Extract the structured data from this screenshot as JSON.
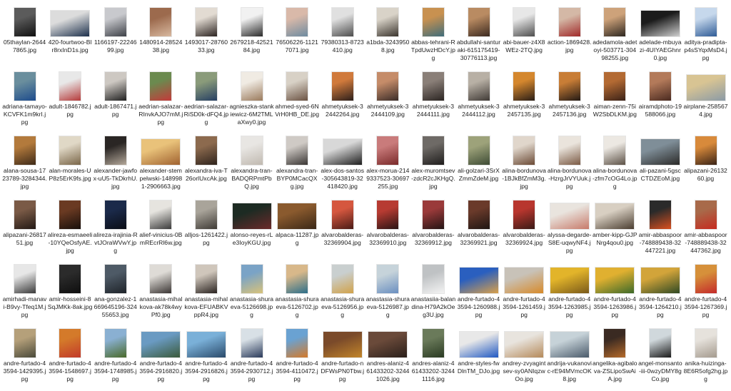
{
  "files": [
    {
      "name": "05thaylan-26447865.jpg",
      "orient": "port",
      "colors": [
        "#5b5b5b",
        "#101010"
      ]
    },
    {
      "name": "420-fourtwoo-Blr8rxInD1s.jpg",
      "orient": "land",
      "colors": [
        "#dcdcdc",
        "#1c2f4b"
      ]
    },
    {
      "name": "1166197-2224699.jpg",
      "orient": "port",
      "colors": [
        "#c8c9cd",
        "#3d4047"
      ]
    },
    {
      "name": "1480914-2852438.jpg",
      "orient": "port",
      "colors": [
        "#9c6a4d",
        "#d8b9a0"
      ]
    },
    {
      "name": "1493017-2876033.jpg",
      "orient": "port",
      "colors": [
        "#e2dbd2",
        "#2b2320"
      ]
    },
    {
      "name": "2679218-4252184.jpg",
      "orient": "port",
      "colors": [
        "#f1f1f1",
        "#2a2a2a"
      ]
    },
    {
      "name": "76506226-11217071.jpg",
      "orient": "port",
      "colors": [
        "#d9b9a9",
        "#6e8ba0"
      ]
    },
    {
      "name": "79380313-8723410.jpg",
      "orient": "port",
      "colors": [
        "#e0e0e0",
        "#4c4c4c"
      ]
    },
    {
      "name": "a1bda-32439508.jpg",
      "orient": "port",
      "colors": [
        "#d9d3c8",
        "#3a342d"
      ]
    },
    {
      "name": "abbas-tehrani-RTpdUwzHDcY.jpg",
      "orient": "port",
      "colors": [
        "#c89150",
        "#3f6d7a"
      ]
    },
    {
      "name": "abdullahi-santuraki-615175419-30776113.jpg",
      "orient": "port",
      "colors": [
        "#b98b62",
        "#3c2a20"
      ]
    },
    {
      "name": "abi-bauer-z4X8WEz-2TQ.jpg",
      "orient": "port",
      "colors": [
        "#e7e7e7",
        "#4d4d4d"
      ]
    },
    {
      "name": "action-1869428.jpg",
      "orient": "port",
      "colors": [
        "#d4b8a6",
        "#a12a2a"
      ]
    },
    {
      "name": "adedamola-adetoyi-503771-30498255.jpg",
      "orient": "port",
      "colors": [
        "#cda27a",
        "#2d2720"
      ]
    },
    {
      "name": "adelade-mbuyazi-4UIYAEGhnr0.jpg",
      "orient": "land",
      "colors": [
        "#1b1b1b",
        "#cfcfcf"
      ]
    },
    {
      "name": "aditya-pradipta-p4sSYqxMsD4.jpg",
      "orient": "port",
      "colors": [
        "#c6d8ec",
        "#2e5b96"
      ]
    },
    {
      "name": "adriana-tamayo-KCVFK1m9krI.jpg",
      "orient": "port",
      "colors": [
        "#6a8e9d",
        "#1d4b8c"
      ]
    },
    {
      "name": "adult-1846782.jpg",
      "orient": "port",
      "colors": [
        "#e8e8e8",
        "#b53a3a"
      ]
    },
    {
      "name": "adult-1867471.jpg",
      "orient": "port",
      "colors": [
        "#cdc8c2",
        "#1f1f1f"
      ]
    },
    {
      "name": "aedrian-salazar-RInvkAJO7mM.jpg",
      "orient": "port",
      "colors": [
        "#6b8a4f",
        "#c43a3a"
      ]
    },
    {
      "name": "aedrian-salazar-RiSD0k-dFQ4.jpg",
      "orient": "port",
      "colors": [
        "#8a9b7a",
        "#263f63"
      ]
    },
    {
      "name": "agnieszka-stankiewicz-6M2TMLaXwy0.jpg",
      "orient": "port",
      "colors": [
        "#f0ebe3",
        "#9a7a5c"
      ]
    },
    {
      "name": "ahmed-syed-6NVrH0HB_DE.jpg",
      "orient": "port",
      "colors": [
        "#d8d1c6",
        "#6b5242"
      ]
    },
    {
      "name": "ahmetyuksek-32442264.jpg",
      "orient": "port",
      "colors": [
        "#d07a3c",
        "#2c1f1b"
      ]
    },
    {
      "name": "ahmetyuksek-32444109.jpg",
      "orient": "port",
      "colors": [
        "#c58c69",
        "#3a2c28"
      ]
    },
    {
      "name": "ahmetyuksek-32444111.jpg",
      "orient": "port",
      "colors": [
        "#8a7f78",
        "#2b2522"
      ]
    },
    {
      "name": "ahmetyuksek-32444112.jpg",
      "orient": "port",
      "colors": [
        "#b8b0a5",
        "#403a36"
      ]
    },
    {
      "name": "ahmetyuksek-32457135.jpg",
      "orient": "port",
      "colors": [
        "#d4872e",
        "#2a1e17"
      ]
    },
    {
      "name": "ahmetyuksek-32457136.jpg",
      "orient": "port",
      "colors": [
        "#c87d36",
        "#231a15"
      ]
    },
    {
      "name": "aiman-zenn-75iW2SbDLKM.jpg",
      "orient": "port",
      "colors": [
        "#b36a33",
        "#3b2218"
      ]
    },
    {
      "name": "airamdphoto-19588066.jpg",
      "orient": "port",
      "colors": [
        "#b37a5a",
        "#4a2a20"
      ]
    },
    {
      "name": "airplane-2585674.jpg",
      "orient": "land",
      "colors": [
        "#d8c493",
        "#8a9aa6"
      ]
    },
    {
      "name": "alana-sousa-1723789-3284344.jpg",
      "orient": "port",
      "colors": [
        "#b37a3c",
        "#3f2b19"
      ]
    },
    {
      "name": "alan-morales-UP8z5ErK9fs.jpg",
      "orient": "port",
      "colors": [
        "#e0d8c6",
        "#7a6648"
      ]
    },
    {
      "name": "alexander-jawfox-uU5-TkDkrhU.jpg",
      "orient": "port",
      "colors": [
        "#2a2624",
        "#b4a89a"
      ]
    },
    {
      "name": "alexander-stempelwski-1489981-2906663.jpg",
      "orient": "land",
      "colors": [
        "#e9c27a",
        "#a06230"
      ]
    },
    {
      "name": "alexandra-iva-T26orlUxcAk.jpg",
      "orient": "port",
      "colors": [
        "#8c6a4e",
        "#2f241d"
      ]
    },
    {
      "name": "alexandra-tran-BADQRPmtPbQ.jpg",
      "orient": "port",
      "colors": [
        "#e8e6e3",
        "#c0b9b0"
      ]
    },
    {
      "name": "alexandra-tran-BYP0MCacQXg.jpg",
      "orient": "port",
      "colors": [
        "#cfcac5",
        "#3a3634"
      ]
    },
    {
      "name": "alex-dos-santos-305643819-32418420.jpg",
      "orient": "land",
      "colors": [
        "#d8d8d8",
        "#1c1c1c"
      ]
    },
    {
      "name": "alex-morua-2149337523-30697255.jpg",
      "orient": "port",
      "colors": [
        "#c97b7b",
        "#7a2a2a"
      ]
    },
    {
      "name": "alex-muromtsev-zdcR2cJKHgQ.jpg",
      "orient": "port",
      "colors": [
        "#6e6a66",
        "#1f1d1c"
      ]
    },
    {
      "name": "ali-golzari-3SrXZmmZdeM.jpg",
      "orient": "port",
      "colors": [
        "#9da27a",
        "#3e4c35"
      ]
    },
    {
      "name": "alina-bordunova-1BJkBfZmM3g.jpg",
      "orient": "port",
      "colors": [
        "#e0d6cb",
        "#6b4a35"
      ]
    },
    {
      "name": "alina-bordunova-HzrgJrVYUuk.jpg",
      "orient": "port",
      "colors": [
        "#eae4dc",
        "#7b5a44"
      ]
    },
    {
      "name": "alina-bordunova-zfm7cOG4Lo.jpg",
      "orient": "port",
      "colors": [
        "#ece8e2",
        "#5c5146"
      ]
    },
    {
      "name": "ali-pazani-5gscCTDZEoM.jpg",
      "orient": "land",
      "colors": [
        "#7f8e98",
        "#2b2a28"
      ]
    },
    {
      "name": "alipazani-2613260.jpg",
      "orient": "port",
      "colors": [
        "#d88a3b",
        "#3a2417"
      ]
    },
    {
      "name": "alipazani-2681751.jpg",
      "orient": "port",
      "colors": [
        "#7a5a46",
        "#231915"
      ]
    },
    {
      "name": "alireza-esmaeeli-10YQeOsfyAE.jpg",
      "orient": "port",
      "colors": [
        "#6a3a22",
        "#180f0b"
      ]
    },
    {
      "name": "alireza-irajinia-RvtJOraWVwY.jpg",
      "orient": "port",
      "colors": [
        "#1b2a4a",
        "#0a0d15"
      ]
    },
    {
      "name": "alief-vinicius-0BmREcrRl6w.jpg",
      "orient": "port",
      "colors": [
        "#e6e4df",
        "#3a3a3a"
      ]
    },
    {
      "name": "alljos-1261422.jpg",
      "orient": "port",
      "colors": [
        "#a9a49a",
        "#3f3b36"
      ]
    },
    {
      "name": "alonso-reyes-rLe3IoyKGU.jpg",
      "orient": "land",
      "colors": [
        "#1d2b23",
        "#6b2a2a"
      ]
    },
    {
      "name": "alpaca-11287.jpg",
      "orient": "land",
      "colors": [
        "#8a5a2e",
        "#3a2716"
      ]
    },
    {
      "name": "alvarobalderas-32369904.jpg",
      "orient": "port",
      "colors": [
        "#d5573f",
        "#4a1b16"
      ]
    },
    {
      "name": "alvarobalderas-32369910.jpg",
      "orient": "port",
      "colors": [
        "#b73b32",
        "#2a1414"
      ]
    },
    {
      "name": "alvarobalderas-32369912.jpg",
      "orient": "port",
      "colors": [
        "#9a3a3a",
        "#241414"
      ]
    },
    {
      "name": "alvarobalderas-32369921.jpg",
      "orient": "port",
      "colors": [
        "#6a3a2a",
        "#1f1613"
      ]
    },
    {
      "name": "alvarobalderas-32369924.jpg",
      "orient": "port",
      "colors": [
        "#b8362e",
        "#3a1a16"
      ]
    },
    {
      "name": "alyssa-degarde-S8E-uqwyNF4.jpg",
      "orient": "land",
      "colors": [
        "#e9e4de",
        "#c77a6a"
      ]
    },
    {
      "name": "amber-kipp-GJPNrg4qou0.jpg",
      "orient": "land",
      "colors": [
        "#d8cfc2",
        "#4a3d30"
      ]
    },
    {
      "name": "amir-abbaspoor-748889438-32447221.jpg",
      "orient": "port",
      "colors": [
        "#2a2a2a",
        "#d94f1f"
      ]
    },
    {
      "name": "amir-abbaspoor-748889438-32447362.jpg",
      "orient": "port",
      "colors": [
        "#a86a4a",
        "#c62a1f"
      ]
    },
    {
      "name": "amirhadi-manavi-B9vy-Tfeq1M.jpg",
      "orient": "port",
      "colors": [
        "#e7e7e7",
        "#3a3a3a"
      ]
    },
    {
      "name": "amir-hosseini-8SqJMKk-8ak.jpg",
      "orient": "port",
      "colors": [
        "#2b2b2b",
        "#0e0e0e"
      ]
    },
    {
      "name": "ana-gonzalez-1669645196-32455653.jpg",
      "orient": "port",
      "colors": [
        "#4e5a66",
        "#1f242a"
      ]
    },
    {
      "name": "anastasia-mihalkova-ak78k4wyPf0.jpg",
      "orient": "port",
      "colors": [
        "#dedbd6",
        "#3a3533"
      ]
    },
    {
      "name": "anastasia-mihalkova-EFUABKVppR4.jpg",
      "orient": "port",
      "colors": [
        "#cfc6bb",
        "#2a2320"
      ]
    },
    {
      "name": "anastasia-shuraeva-5126698.jpg",
      "orient": "port",
      "colors": [
        "#7aa3c6",
        "#d8c27a"
      ]
    },
    {
      "name": "anastasia-shuraeva-5126702.jpg",
      "orient": "port",
      "colors": [
        "#d8b88a",
        "#2c6f8a"
      ]
    },
    {
      "name": "anastasia-shuraeva-5126956.jpg",
      "orient": "port",
      "colors": [
        "#c9cfcf",
        "#d1a24a"
      ]
    },
    {
      "name": "anastasia-shuraeva-5126987.jpg",
      "orient": "port",
      "colors": [
        "#c6d3da",
        "#6a8fc0"
      ]
    },
    {
      "name": "anastasiia-balandina-H79A2kOeg3U.jpg",
      "orient": "port",
      "colors": [
        "#bfc2c4",
        "#f3f3f3"
      ]
    },
    {
      "name": "andre-furtado-43594-1260988.jpg",
      "orient": "land",
      "colors": [
        "#2a5fbf",
        "#d9a04a"
      ]
    },
    {
      "name": "andre-furtado-43594-1261459.jpg",
      "orient": "land",
      "colors": [
        "#c8c2b8",
        "#d78a2a"
      ]
    },
    {
      "name": "andre-furtado-43594-1263985.jpg",
      "orient": "land",
      "colors": [
        "#e2b42a",
        "#7a5a1a"
      ]
    },
    {
      "name": "andre-furtado-43594-1263986.jpg",
      "orient": "land",
      "colors": [
        "#e0b030",
        "#3c6a2a"
      ]
    },
    {
      "name": "andre-furtado-43594-1264210.jpg",
      "orient": "land",
      "colors": [
        "#d2a43a",
        "#2f4a24"
      ]
    },
    {
      "name": "andre-furtado-43594-1267369.jpg",
      "orient": "port",
      "colors": [
        "#d6903a",
        "#c42a2a"
      ]
    },
    {
      "name": "andre-furtado-43594-1429395.jpg",
      "orient": "port",
      "colors": [
        "#b5a07a",
        "#4a4a3a"
      ]
    },
    {
      "name": "andre-furtado-43594-1548697.jpg",
      "orient": "port",
      "colors": [
        "#d47a2a",
        "#c23a2a"
      ]
    },
    {
      "name": "andre-furtado-43594-1748985.jpg",
      "orient": "port",
      "colors": [
        "#8ab0d2",
        "#4a6a2a"
      ]
    },
    {
      "name": "andre-furtado-43594-2916820.jpg",
      "orient": "land",
      "colors": [
        "#6a9ac2",
        "#3a5a3a"
      ]
    },
    {
      "name": "andre-furtado-43594-2916826.jpg",
      "orient": "land",
      "colors": [
        "#7ab0d8",
        "#2a4a6a"
      ]
    },
    {
      "name": "andre-furtado-43594-2930712.jpg",
      "orient": "port",
      "colors": [
        "#d8e0e6",
        "#2a3a5a"
      ]
    },
    {
      "name": "andre-furtado-43594-4110472.jpg",
      "orient": "port",
      "colors": [
        "#6aa2d2",
        "#d47a2a"
      ]
    },
    {
      "name": "andre-furtado-nDFWsPN0Tbw.jpg",
      "orient": "land",
      "colors": [
        "#7a4a2a",
        "#c2852a"
      ]
    },
    {
      "name": "andres-alaniz-461433202-32441026.jpg",
      "orient": "land",
      "colors": [
        "#6a4a3a",
        "#2a1f1a"
      ]
    },
    {
      "name": "andres-alaniz-461433202-32441116.jpg",
      "orient": "port",
      "colors": [
        "#6a7a5a",
        "#2a3a22"
      ]
    },
    {
      "name": "andre-styles-fwDlnTM_DJo.jpg",
      "orient": "land",
      "colors": [
        "#e8e8e8",
        "#2058c2"
      ]
    },
    {
      "name": "andrey-zvyagintsev-sy0ANIqzwOo.jpg",
      "orient": "land",
      "colors": [
        "#e8e4de",
        "#b58a5a"
      ]
    },
    {
      "name": "andrija-vukanovic-rE94MVmcOK8.jpg",
      "orient": "land",
      "colors": [
        "#c6d2d8",
        "#4a5a6a"
      ]
    },
    {
      "name": "angelika-agibalova-ZSLipoSwAiA.jpg",
      "orient": "port",
      "colors": [
        "#3a2a22",
        "#b56a2a"
      ]
    },
    {
      "name": "angel-monsanto-iii-0wzyDMY8gCo.jpg",
      "orient": "port",
      "colors": [
        "#d0d8dc",
        "#1a1a1a"
      ]
    },
    {
      "name": "anika-huizinga-8E6R5ofg2hg.jpg",
      "orient": "port",
      "colors": [
        "#e6e2dc",
        "#a49a8e"
      ]
    }
  ]
}
